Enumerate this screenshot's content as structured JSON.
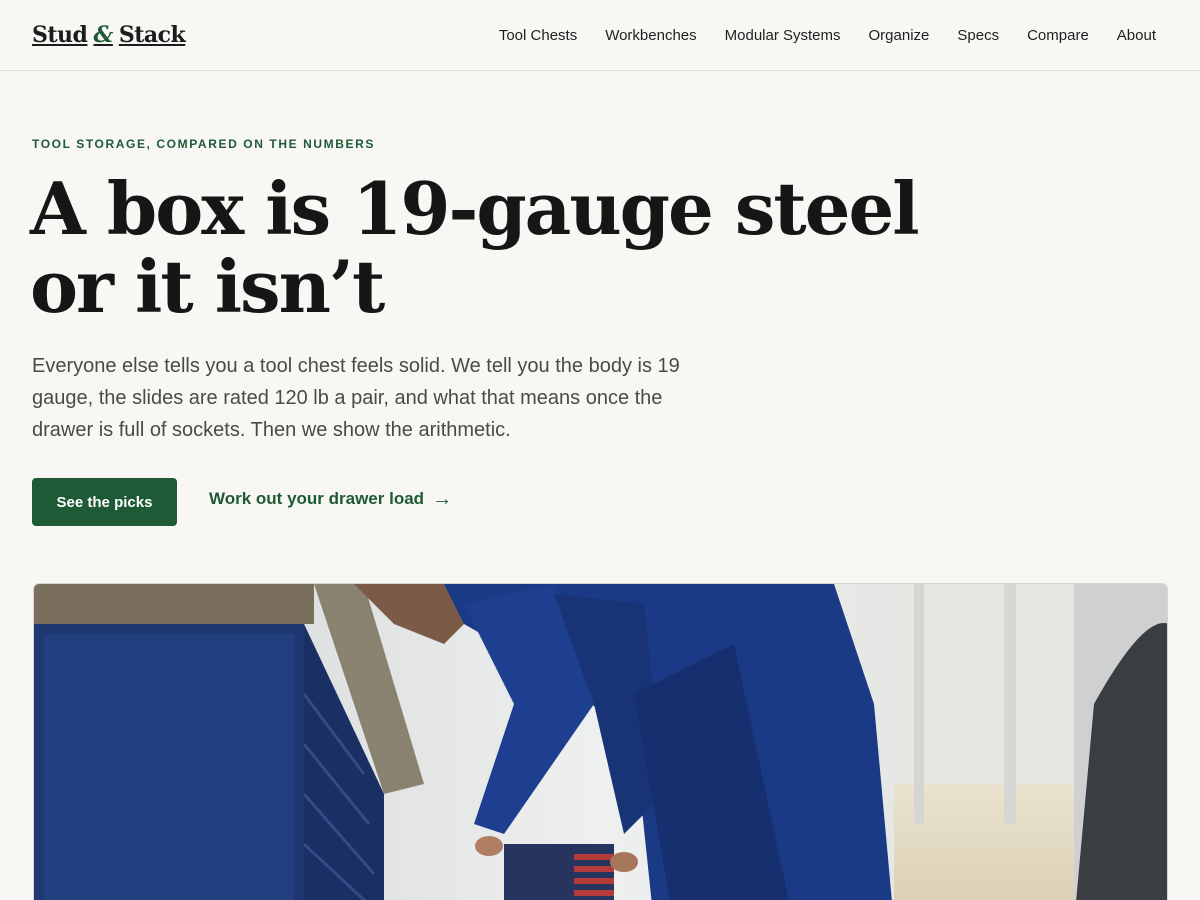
{
  "header": {
    "logo": {
      "part1": "Stud",
      "amp": "&",
      "part2": "Stack"
    },
    "nav": [
      "Tool Chests",
      "Workbenches",
      "Modular Systems",
      "Organize",
      "Specs",
      "Compare",
      "About"
    ]
  },
  "hero": {
    "eyebrow": "TOOL STORAGE, COMPARED ON THE NUMBERS",
    "headline": "A box is 19-gauge steel or it isn’t",
    "lede": "Everyone else tells you a tool chest feels solid. We tell you the body is 19 gauge, the slides are rated 120 lb a pair, and what that means once the drawer is full of sockets. Then we show the arithmetic.",
    "primary_button": "See the picks",
    "secondary_link": "Work out your drawer load",
    "arrow": "→"
  },
  "image": {
    "subject": "mechanic in blue coveralls bending over a blue steel workbench with drawers in a workshop"
  },
  "colors": {
    "accent": "#1d5a35",
    "background": "#f8f7f4",
    "text": "#161616"
  }
}
